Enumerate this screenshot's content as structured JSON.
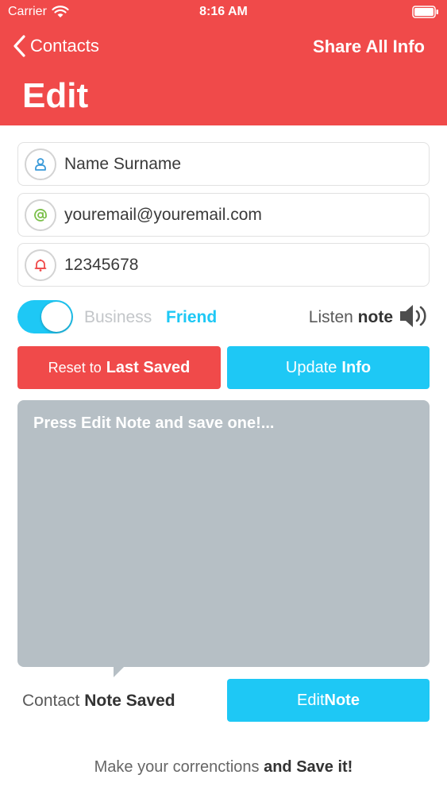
{
  "status_bar": {
    "carrier": "Carrier",
    "time": "8:16 AM"
  },
  "nav": {
    "back_label": "Contacts",
    "share_label": "Share All Info",
    "title": "Edit"
  },
  "fields": {
    "name": {
      "value": "Name Surname",
      "icon": "person-icon",
      "icon_color": "#3a9ad9"
    },
    "email": {
      "value": "youremail@youremail.com",
      "icon": "at-sign-icon",
      "icon_color": "#7cc04b"
    },
    "phone": {
      "value": "12345678",
      "icon": "bell-icon",
      "icon_color": "#f04a4a"
    }
  },
  "toggle": {
    "on": true,
    "business_label": "Business",
    "friend_label": "Friend"
  },
  "listen": {
    "prefix": "Listen",
    "bold": "note",
    "icon": "speaker-icon"
  },
  "buttons": {
    "reset_prefix": "Reset to",
    "reset_bold": "Last Saved",
    "update_prefix": "Update",
    "update_bold": "Info",
    "edit_prefix": "Edit",
    "edit_bold": "Note"
  },
  "note": {
    "text": "Press Edit Note and save one!..."
  },
  "saved": {
    "prefix": "Contact",
    "bold": "Note Saved"
  },
  "footer": {
    "prefix": "Make your correnctions",
    "bold": "and Save it!"
  },
  "colors": {
    "header": "#f04a4a",
    "accent": "#1ec8f5",
    "note_bg": "#b6bfc5"
  }
}
